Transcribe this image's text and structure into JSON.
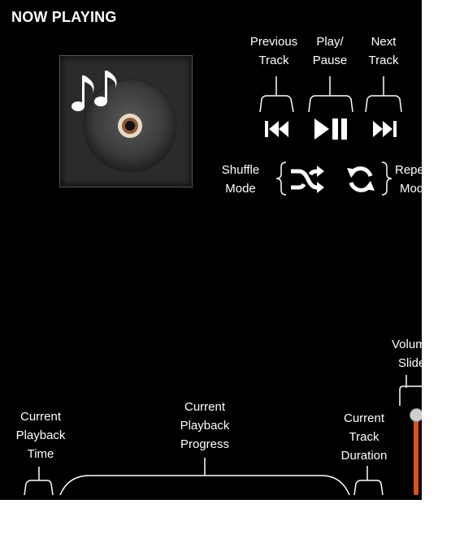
{
  "app": {
    "title": "NOW PLAYING"
  },
  "annotations": {
    "previous_track": [
      "Previous",
      "Track"
    ],
    "play_pause": [
      "Play/",
      "Pause"
    ],
    "next_track": [
      "Next",
      "Track"
    ],
    "shuffle_mode": [
      "Shuffle",
      "Mode"
    ],
    "repeat_mode": [
      "Repeat",
      "Mode"
    ],
    "volume_slider": [
      "Volume",
      "Slider"
    ],
    "current_playback_time": [
      "Current",
      "Playback",
      "Time"
    ],
    "current_playback_progress": [
      "Current",
      "Playback",
      "Progress"
    ],
    "current_track_duration": [
      "Current",
      "Track",
      "Duration"
    ]
  },
  "icons": {
    "previous": "skip-previous-icon",
    "play_pause": "play-pause-icon",
    "next": "skip-next-icon",
    "shuffle": "shuffle-icon",
    "repeat": "repeat-icon",
    "album_art": "music-notes-disc-icon"
  },
  "volume": {
    "level": 0.95
  },
  "colors": {
    "background": "#000000",
    "text": "#ffffff",
    "volume_fill": "#d9531e"
  }
}
